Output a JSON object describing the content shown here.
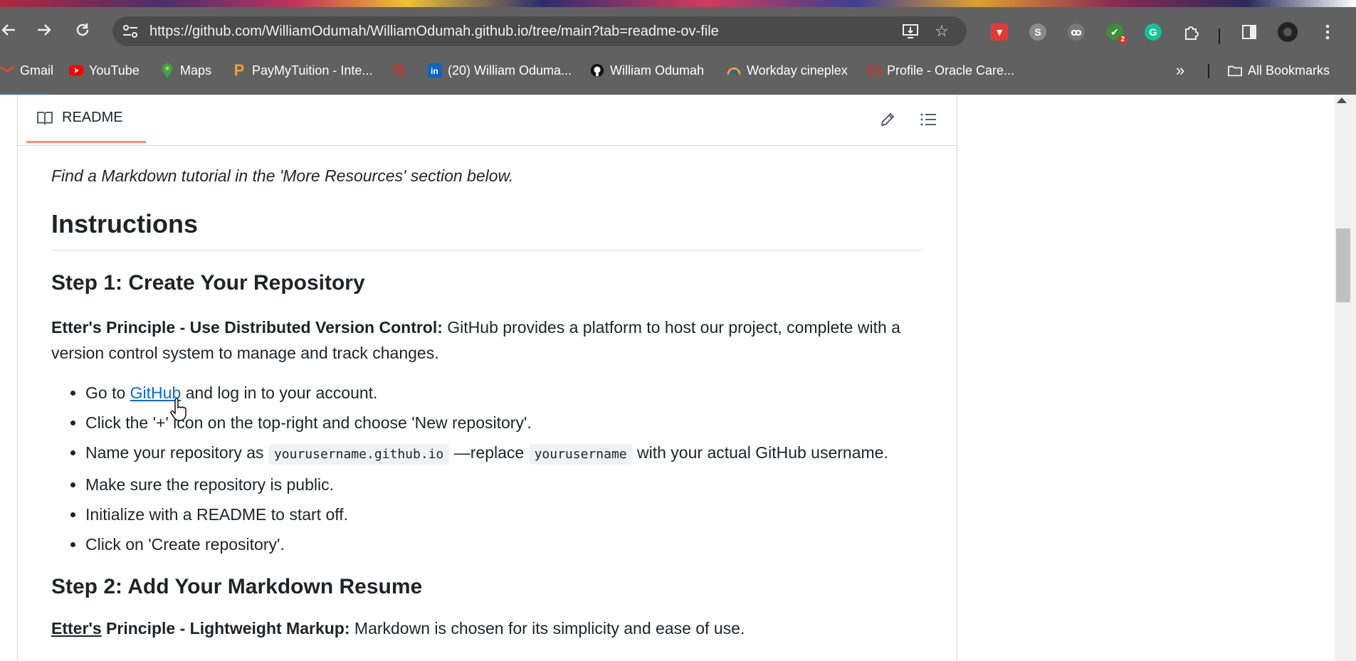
{
  "browser": {
    "url": "https://github.com/WilliamOdumah/WilliamOdumah.github.io/tree/main?tab=readme-ov-file",
    "extension_badge": "2"
  },
  "bookmarks": [
    {
      "label": "Gmail",
      "icon": "gmail-icon"
    },
    {
      "label": "YouTube",
      "icon": "youtube-icon"
    },
    {
      "label": "Maps",
      "icon": "maps-icon"
    },
    {
      "label": "PayMyTuition - Inte...",
      "icon": "paymytuition-icon"
    },
    {
      "label": "",
      "icon": "search-lens-icon"
    },
    {
      "label": "(20) William Oduma...",
      "icon": "linkedin-icon"
    },
    {
      "label": "William Odumah",
      "icon": "github-icon"
    },
    {
      "label": "Workday cineplex",
      "icon": "workday-icon"
    },
    {
      "label": "Profile - Oracle Care...",
      "icon": "oracle-icon"
    }
  ],
  "all_bookmarks_label": "All Bookmarks",
  "readme": {
    "tab_label": "README",
    "intro": "Find a Markdown tutorial in the 'More Resources' section below.",
    "h1": "Instructions",
    "step1": {
      "heading": "Step 1: Create Your Repository",
      "principle_bold": "Etter's Principle - Use Distributed Version Control:",
      "principle_text": " GitHub provides a platform to host our project, complete with a version control system to manage and track changes.",
      "item1_pre": "Go to ",
      "item1_link": "GitHub",
      "item1_post": " and log in to your account.",
      "item2": "Click the '+' icon on the top-right and choose 'New repository'.",
      "item3_pre": "Name your repository as ",
      "item3_code1": "yourusername.github.io",
      "item3_mid": " —replace ",
      "item3_code2": "yourusername",
      "item3_post": " with your actual GitHub username.",
      "item4": "Make sure the repository is public.",
      "item5": "Initialize with a README to start off.",
      "item6": "Click on 'Create repository'."
    },
    "step2": {
      "heading": "Step 2: Add Your Markdown Resume",
      "principle_bold_a": "Etter's",
      "principle_bold_b": " Principle - Lightweight Markup:",
      "principle_text": " Markdown is chosen for its simplicity and ease of use."
    }
  }
}
